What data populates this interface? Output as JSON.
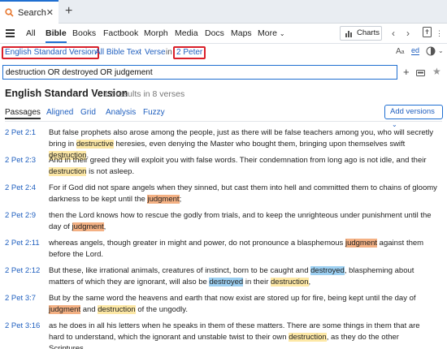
{
  "tab": {
    "label": "Search"
  },
  "toolbar": {
    "items": [
      "All",
      "Bible",
      "Books",
      "Factbook",
      "Morph",
      "Media",
      "Docs",
      "Maps",
      "More"
    ],
    "active": "Bible",
    "charts_label": "Charts"
  },
  "scope": {
    "version": "English Standard Version",
    "text": "All Bible Text",
    "unit": "Verse",
    "in_word": "in",
    "range": "2 Peter"
  },
  "search": {
    "query": "destruction OR destroyed OR judgement"
  },
  "results": {
    "title": "English Standard Version",
    "count": "12 results in 8 verses"
  },
  "view_tabs": [
    "Passages",
    "Aligned",
    "Grid",
    "Analysis",
    "Fuzzy"
  ],
  "add_versions_label": "Add versions",
  "verses": [
    {
      "ref": "2 Pet 2:1",
      "parts": [
        {
          "t": "But false prophets also arose among the people, just as there will be false teachers among you, who will secretly bring in "
        },
        {
          "t": "destructive",
          "hl": "y"
        },
        {
          "t": " heresies, even denying the Master who bought them, bringing upon themselves swift "
        },
        {
          "t": "destruction",
          "hl": "y"
        },
        {
          "t": "."
        }
      ]
    },
    {
      "ref": "2 Pet 2:3",
      "parts": [
        {
          "t": "And in their greed they will exploit you with false words. Their condemnation from long ago is not idle, and their "
        },
        {
          "t": "destruction",
          "hl": "y"
        },
        {
          "t": " is not asleep."
        }
      ]
    },
    {
      "ref": "2 Pet 2:4",
      "parts": [
        {
          "t": "For if God did not spare angels when they sinned, but cast them into hell and committed them to chains of gloomy darkness to be kept until the "
        },
        {
          "t": "judgment",
          "hl": "o"
        },
        {
          "t": ";"
        }
      ]
    },
    {
      "ref": "2 Pet 2:9",
      "parts": [
        {
          "t": "then the Lord knows how to rescue the godly from trials, and to keep the unrighteous under punishment until the day of "
        },
        {
          "t": "judgment",
          "hl": "o"
        },
        {
          "t": ","
        }
      ]
    },
    {
      "ref": "2 Pet 2:11",
      "parts": [
        {
          "t": "whereas angels, though greater in might and power, do not pronounce a blasphemous "
        },
        {
          "t": "judgment",
          "hl": "o"
        },
        {
          "t": " against them before the Lord."
        }
      ]
    },
    {
      "ref": "2 Pet 2:12",
      "parts": [
        {
          "t": "But these, like irrational animals, creatures of instinct, born to be caught and "
        },
        {
          "t": "destroyed",
          "hl": "b"
        },
        {
          "t": ", blaspheming about matters of which they are ignorant, will also be "
        },
        {
          "t": "destroyed",
          "hl": "b"
        },
        {
          "t": " in their "
        },
        {
          "t": "destruction",
          "hl": "y"
        },
        {
          "t": ","
        }
      ]
    },
    {
      "ref": "2 Pet 3:7",
      "parts": [
        {
          "t": "But by the same word the heavens and earth that now exist are stored up for fire, being kept until the day of "
        },
        {
          "t": "judgment",
          "hl": "o"
        },
        {
          "t": " and "
        },
        {
          "t": "destruction",
          "hl": "y"
        },
        {
          "t": " of the ungodly."
        }
      ]
    },
    {
      "ref": "2 Pet 3:16",
      "parts": [
        {
          "t": "as he does in all his letters when he speaks in them of these matters. There are some things in them that are hard to understand, which the ignorant and unstable twist to their own "
        },
        {
          "t": "destruction",
          "hl": "y"
        },
        {
          "t": ", as they do the other Scriptures."
        }
      ]
    }
  ],
  "colors": {
    "accent": "#1f6fd1",
    "highlight_judgment": "#f4b184",
    "highlight_destruction": "#fde8a6",
    "highlight_destroyed": "#9dd0f2",
    "scope_border": "#d9202a"
  }
}
